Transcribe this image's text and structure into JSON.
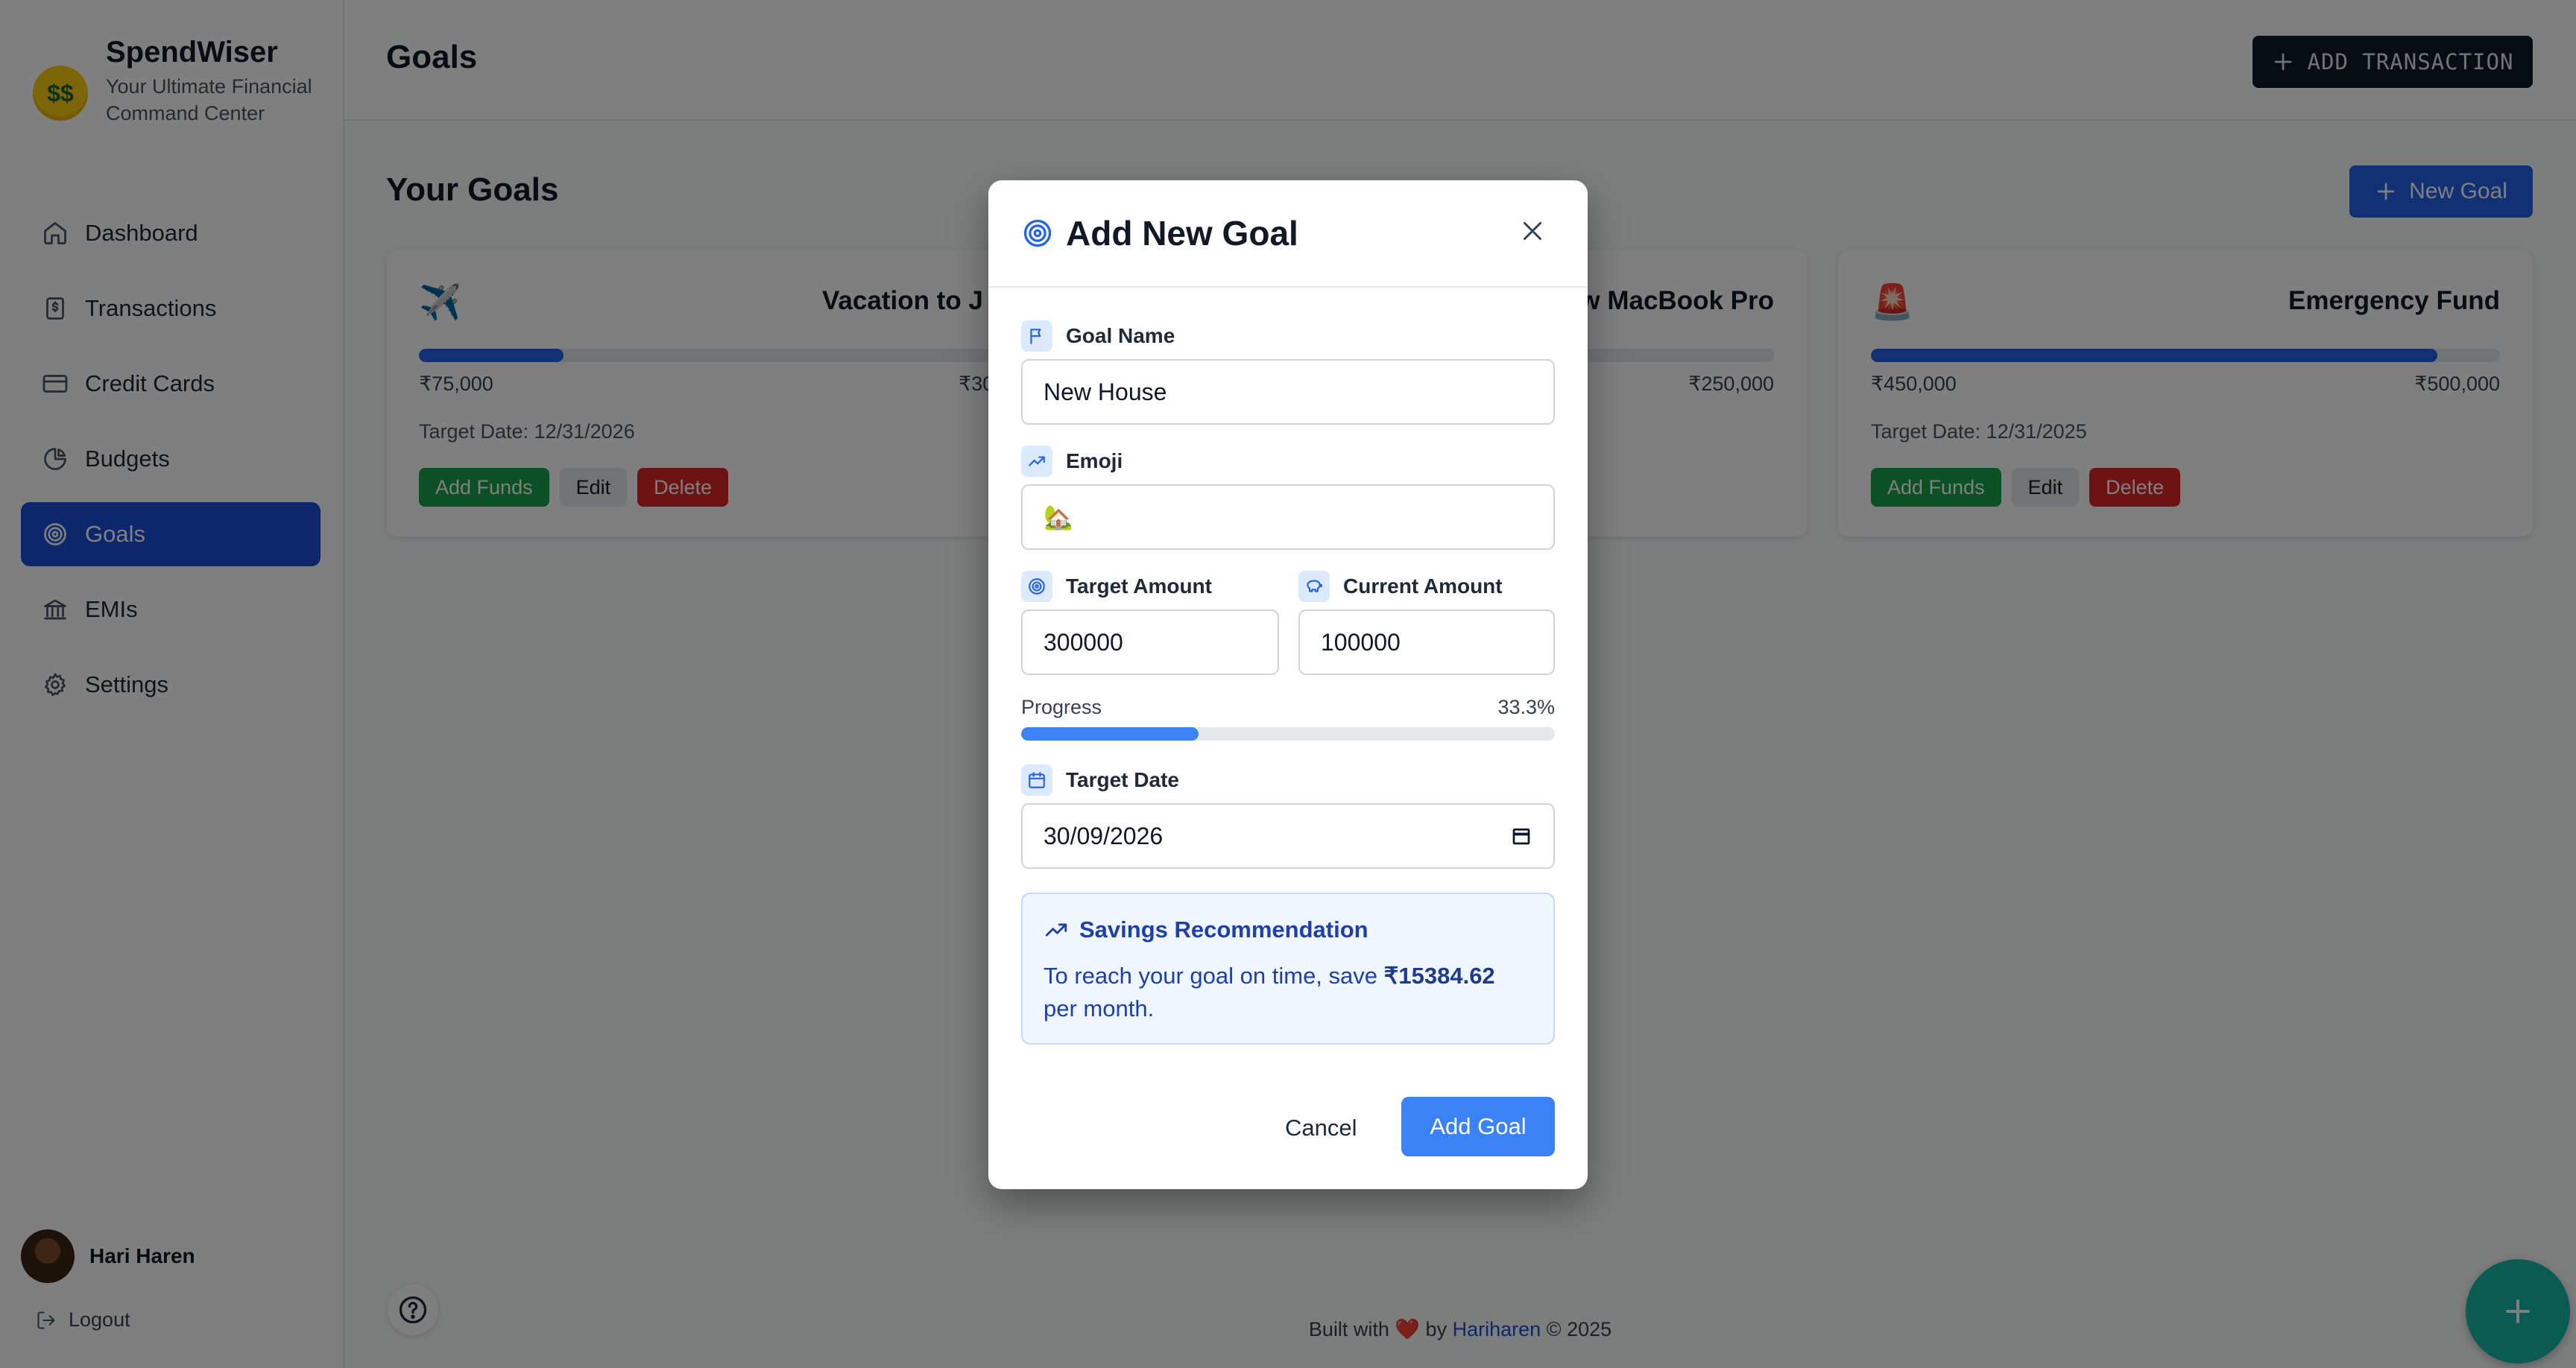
{
  "brand": {
    "name": "SpendWiser",
    "tagline": "Your Ultimate Financial Command Center",
    "logo_icon": "money-face-emoji"
  },
  "nav": {
    "items": [
      {
        "label": "Dashboard",
        "icon": "home-icon"
      },
      {
        "label": "Transactions",
        "icon": "dollar-document-icon"
      },
      {
        "label": "Credit Cards",
        "icon": "credit-card-icon"
      },
      {
        "label": "Budgets",
        "icon": "pie-chart-icon"
      },
      {
        "label": "Goals",
        "icon": "target-icon",
        "active": true
      },
      {
        "label": "EMIs",
        "icon": "bank-icon"
      },
      {
        "label": "Settings",
        "icon": "gear-icon"
      }
    ]
  },
  "user": {
    "name": "Hari Haren",
    "logout_label": "Logout"
  },
  "header": {
    "title": "Goals",
    "add_transaction_label": "ADD TRANSACTION"
  },
  "main": {
    "section_title": "Your Goals",
    "new_goal_label": "New Goal",
    "goals": [
      {
        "emoji": "✈️",
        "title": "Vacation to Japan",
        "title_visible": "Vacation to J",
        "current": "₹75,000",
        "target": "₹300,000",
        "target_visible": "₹30",
        "progress": 0.25,
        "date_label": "Target Date: 12/31/2026"
      },
      {
        "emoji": "",
        "title": "New MacBook Pro",
        "title_visible": "w MacBook Pro",
        "current": "",
        "target": "₹250,000",
        "progress": 0.8,
        "date_label": ""
      },
      {
        "emoji": "🚨",
        "title": "Emergency Fund",
        "current": "₹450,000",
        "target": "₹500,000",
        "progress": 0.9,
        "date_label": "Target Date: 12/31/2025"
      }
    ],
    "card_actions": {
      "add_funds": "Add Funds",
      "edit": "Edit",
      "delete": "Delete"
    }
  },
  "footer": {
    "prefix": "Built with",
    "heart": "❤️",
    "by": "by",
    "author": "Hariharen",
    "copyright": "© 2025"
  },
  "modal": {
    "title": "Add New Goal",
    "fields": {
      "goal_name": {
        "label": "Goal Name",
        "value": "New House"
      },
      "emoji": {
        "label": "Emoji",
        "value": "🏡"
      },
      "target_amount": {
        "label": "Target Amount",
        "value": "300000"
      },
      "current_amount": {
        "label": "Current Amount",
        "value": "100000"
      },
      "target_date": {
        "label": "Target Date",
        "value": "30/09/2026"
      }
    },
    "progress": {
      "label": "Progress",
      "value_label": "33.3%",
      "fraction": 0.333
    },
    "recommendation": {
      "title": "Savings Recommendation",
      "text_before": "To reach your goal on time, save",
      "amount": "₹15384.62",
      "text_after": "per month."
    },
    "cancel_label": "Cancel",
    "submit_label": "Add Goal"
  },
  "colors": {
    "primary": "#2563eb",
    "sidebar_active": "#1d4ed8",
    "success": "#16a34a",
    "danger": "#dc2626",
    "fab": "#14b8a6"
  }
}
